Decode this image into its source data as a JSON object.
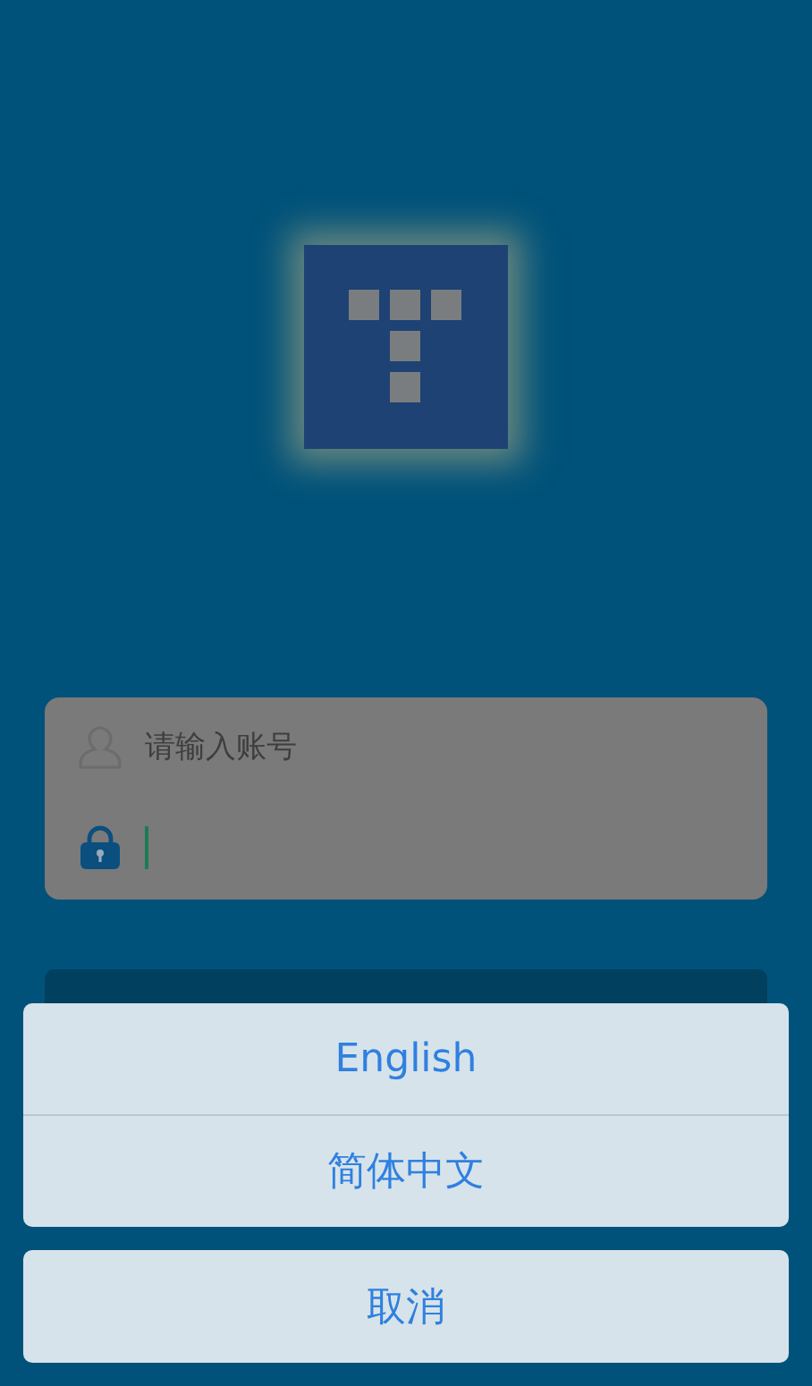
{
  "login_form": {
    "account": {
      "placeholder": "请输入账号"
    },
    "password": {
      "focused": true
    }
  },
  "language_sheet": {
    "options": [
      {
        "label": "English"
      },
      {
        "label": "简体中文"
      }
    ],
    "cancel": "取消"
  }
}
